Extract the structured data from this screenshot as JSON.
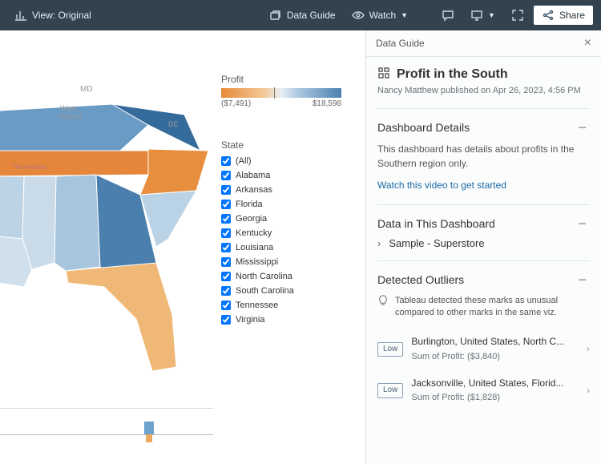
{
  "toolbar": {
    "view_label": "View: Original",
    "data_guide": "Data Guide",
    "watch": "Watch",
    "share": "Share"
  },
  "legend": {
    "title": "Profit",
    "min_label": "($7,491)",
    "max_label": "$18,598"
  },
  "state_filter": {
    "title": "State",
    "items": [
      "(All)",
      "Alabama",
      "Arkansas",
      "Florida",
      "Georgia",
      "Kentucky",
      "Louisiana",
      "Mississippi",
      "North Carolina",
      "South Carolina",
      "Tennessee",
      "Virginia"
    ]
  },
  "chart_data": {
    "type": "map",
    "title": "Profit in the South",
    "color_field": "Profit",
    "color_domain": [
      -7491,
      18598
    ],
    "states": [
      {
        "name": "Virginia",
        "profit": 18598,
        "fill": "#346b9b"
      },
      {
        "name": "Georgia",
        "profit": 15000,
        "fill": "#4a7fae"
      },
      {
        "name": "Kentucky",
        "profit": 11000,
        "fill": "#6a9bc4"
      },
      {
        "name": "Alabama",
        "profit": 6000,
        "fill": "#a7c6de"
      },
      {
        "name": "Arkansas",
        "profit": 4000,
        "fill": "#bcd3e5"
      },
      {
        "name": "Mississippi",
        "profit": 3000,
        "fill": "#c9dbe9"
      },
      {
        "name": "South Carolina",
        "profit": 2000,
        "fill": "#bad2e5"
      },
      {
        "name": "Louisiana",
        "profit": 1500,
        "fill": "#cfdfeb"
      },
      {
        "name": "Florida",
        "profit": -3000,
        "fill": "#f0b877"
      },
      {
        "name": "North Carolina",
        "profit": -6500,
        "fill": "#e88f3f"
      },
      {
        "name": "Tennessee",
        "profit": -7491,
        "fill": "#e6863a"
      }
    ]
  },
  "panel": {
    "header": "Data Guide",
    "title": "Profit in the South",
    "subtitle": "Nancy Matthew published on Apr 26, 2023, 4:56 PM",
    "details": {
      "title": "Dashboard Details",
      "desc": "This dashboard has details about profits in the Southern region only.",
      "link": "Watch this video to get started"
    },
    "data": {
      "title": "Data in This Dashboard",
      "source": "Sample - Superstore"
    },
    "outliers": {
      "title": "Detected Outliers",
      "note": "Tableau detected these marks as unusual compared to other marks in the same viz.",
      "tag_label": "Low",
      "items": [
        {
          "loc": "Burlington, United States, North C...",
          "val": "Sum of Profit: ($3,840)"
        },
        {
          "loc": "Jacksonville, United States, Florid...",
          "val": "Sum of Profit: ($1,828)"
        }
      ]
    }
  }
}
